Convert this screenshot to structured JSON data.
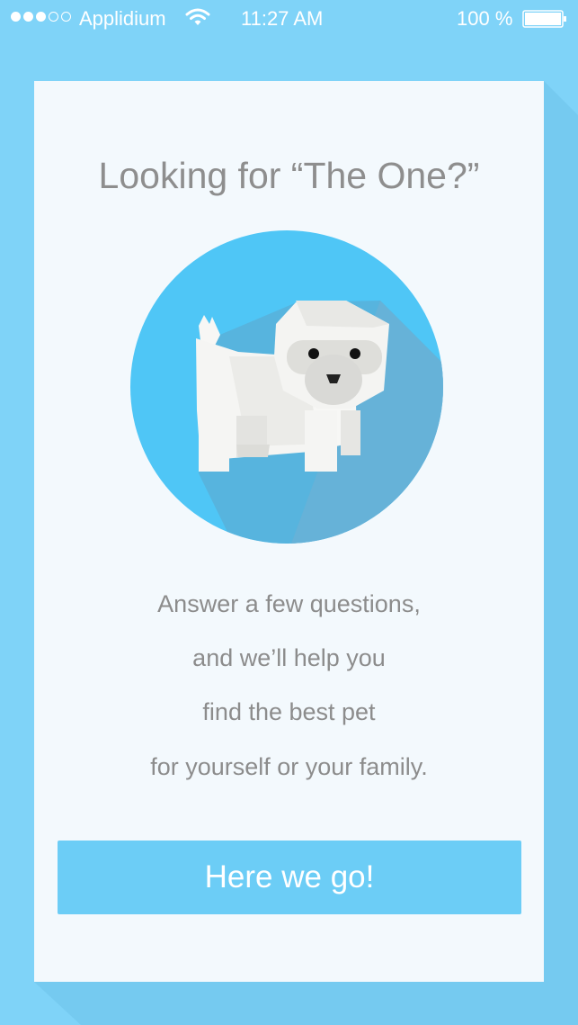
{
  "status_bar": {
    "signal_dots": [
      "full",
      "full",
      "full",
      "empty",
      "empty"
    ],
    "carrier": "Applidium",
    "time": "11:27 AM",
    "battery_percent": "100 %",
    "wifi_icon": "wifi-icon",
    "battery_icon": "battery-icon"
  },
  "onboarding": {
    "title": "Looking for “The One?”",
    "illustration": "dog-illustration",
    "message_lines": [
      "Answer a few questions,",
      "and we’ll help you",
      "find the best pet",
      "for yourself or your family."
    ],
    "cta_label": "Here we go!"
  },
  "colors": {
    "background": "#7fd3f8",
    "card": "#f3f9fd",
    "circle": "#4fc6f6",
    "button": "#6ccdf6",
    "text": "#8e8e8e"
  }
}
